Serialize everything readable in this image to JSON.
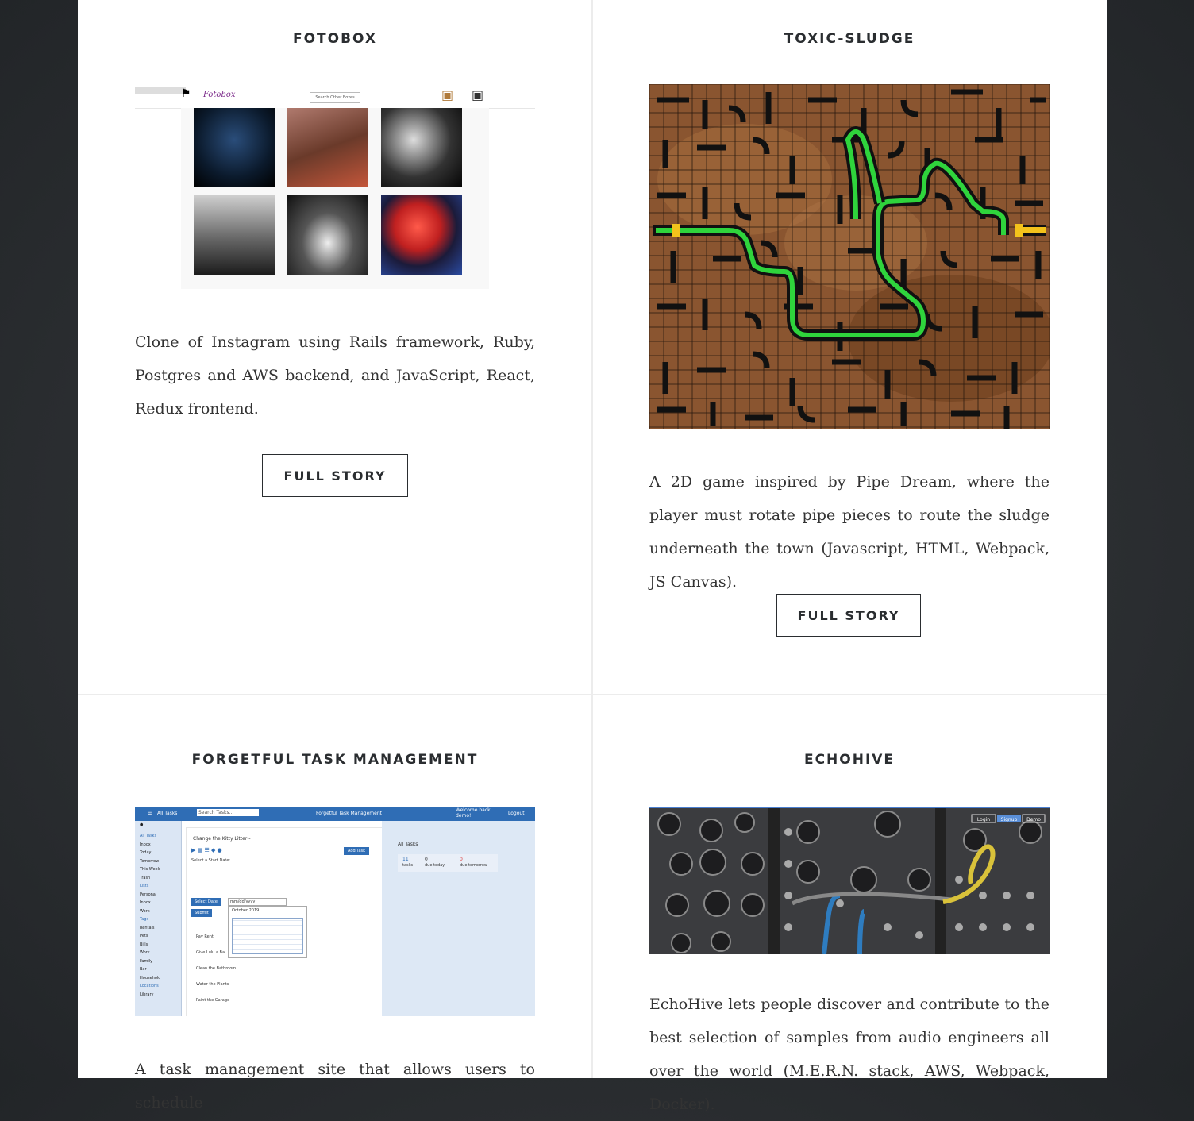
{
  "projects": [
    {
      "title": "FOTOBOX",
      "description": "Clone of Instagram using Rails framework, Ruby, Postgres and AWS backend, and JavaScript, React, Redux frontend.",
      "button": "FULL STORY",
      "screenshot": {
        "logo": "Fotobox",
        "search_placeholder": "Search Other Boxes"
      }
    },
    {
      "title": "TOXIC-SLUDGE",
      "description": "A 2D game inspired by Pipe Dream, where the player must rotate pipe pieces to route the sludge underneath the town (Javascript, HTML, Webpack, JS Canvas).",
      "button": "FULL STORY"
    },
    {
      "title": "FORGETFUL TASK MANAGEMENT",
      "description": "A task management site that allows users to schedule",
      "screenshot": {
        "top_left": "All Tasks",
        "search": "Search Tasks...",
        "app_title": "Forgetful Task Management",
        "welcome": "Welcome back, demo!",
        "logout": "Logout",
        "sidebar": [
          "All Tasks",
          "Inbox",
          "Today",
          "Tomorrow",
          "This Week",
          "Trash",
          "Lists",
          "Personal",
          "Inbox",
          "Work",
          "Tags",
          "Rentals",
          "Pets",
          "Bills",
          "Work",
          "Family",
          "Bar",
          "Household",
          "Locations",
          "Library"
        ],
        "task_name": "Change the Kitty Litter~",
        "start_date_label": "Select a Start Date:",
        "add_task": "Add Task",
        "select_date": "Select Date",
        "submit": "Submit",
        "date_input": "mm/dd/yyyy",
        "month": "October 2019",
        "tasks": [
          "Pay Rent",
          "Give Lulu a Ba",
          "Clean the Bathroom",
          "Water the Plants",
          "Paint the Garage"
        ],
        "right_title": "All Tasks",
        "stats": [
          {
            "count": "11",
            "label": "tasks"
          },
          {
            "count": "0",
            "label": "due today"
          },
          {
            "count": "0",
            "label": "due tomorrow"
          }
        ]
      }
    },
    {
      "title": "ECHOHIVE",
      "description": "EchoHive lets people discover and contribute to the best selection of samples from audio engineers all over the world (M.E.R.N. stack, AWS, Webpack, Docker).",
      "screenshot": {
        "login": "Login",
        "signup": "Signup",
        "demo": "Demo"
      }
    }
  ]
}
